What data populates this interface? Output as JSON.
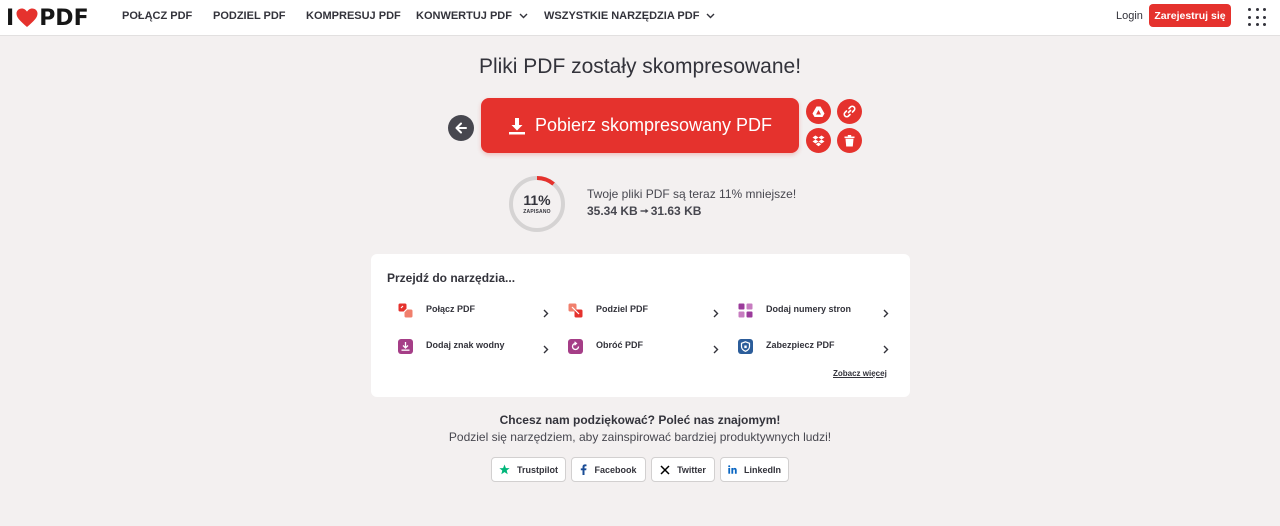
{
  "header": {
    "logo_i": "I",
    "logo_pdf": "PDF",
    "nav": [
      {
        "label": "POŁĄCZ PDF"
      },
      {
        "label": "PODZIEL PDF"
      },
      {
        "label": "KOMPRESUJ PDF"
      },
      {
        "label": "KONWERTUJ PDF"
      },
      {
        "label": "WSZYSTKIE NARZĘDZIA PDF"
      }
    ],
    "login": "Login",
    "register": "Zarejestruj się"
  },
  "main": {
    "title": "Pliki PDF zostały skompresowane!",
    "download_label": "Pobierz skompresowany PDF",
    "result": {
      "percent_text": "11%",
      "saved_label": "ZAPISANO",
      "saved_fraction": 0.11,
      "message": "Twoje pliki PDF są teraz 11% mniejsze!",
      "size_before": "35.34 KB",
      "size_after": "31.63 KB"
    }
  },
  "tools": {
    "heading": "Przejdź do narzędzia...",
    "items": [
      {
        "label": "Połącz PDF",
        "icon": "merge-icon",
        "color": "#e5322d"
      },
      {
        "label": "Podziel PDF",
        "icon": "split-icon",
        "color": "#e5322d"
      },
      {
        "label": "Dodaj numery stron",
        "icon": "page-numbers-icon",
        "color": "#9b3b9b"
      },
      {
        "label": "Dodaj znak wodny",
        "icon": "watermark-icon",
        "color": "#a53e87"
      },
      {
        "label": "Obróć PDF",
        "icon": "rotate-icon",
        "color": "#a53e87"
      },
      {
        "label": "Zabezpiecz PDF",
        "icon": "protect-icon",
        "color": "#2c5d9a"
      }
    ],
    "see_more": "Zobacz więcej"
  },
  "share": {
    "title": "Chcesz nam podziękować? Poleć nas znajomym!",
    "subtitle": "Podziel się narzędziem, aby zainspirować bardziej produktywnych ludzi!",
    "buttons": [
      {
        "label": "Trustpilot",
        "icon": "trustpilot-star-icon",
        "color": "#00b67a"
      },
      {
        "label": "Facebook",
        "icon": "facebook-icon",
        "color": "#1a4c96"
      },
      {
        "label": "Twitter",
        "icon": "x-icon",
        "color": "#000000"
      },
      {
        "label": "LinkedIn",
        "icon": "linkedin-icon",
        "color": "#0a66c2"
      }
    ]
  },
  "colors": {
    "brand": "#e5322d",
    "text": "#33333b",
    "background": "#f3f0f0"
  }
}
